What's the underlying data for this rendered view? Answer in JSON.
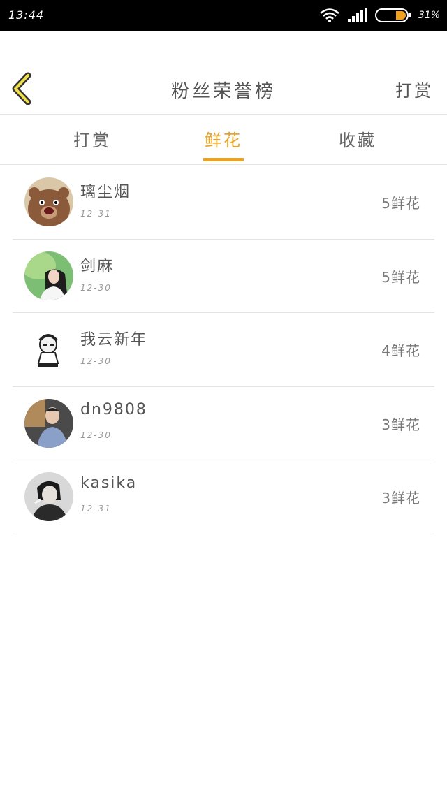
{
  "status_bar": {
    "time": "13:44",
    "battery": "31%"
  },
  "nav": {
    "title": "粉丝荣誉榜",
    "action": "打赏"
  },
  "tabs": [
    {
      "label": "打赏",
      "active": false
    },
    {
      "label": "鲜花",
      "active": true
    },
    {
      "label": "收藏",
      "active": false
    }
  ],
  "colors": {
    "accent": "#e8a324",
    "text": "#666666",
    "divider": "#e3e3e3"
  },
  "items": [
    {
      "name": "璃尘烟",
      "date": "12-31",
      "count": "5鲜花"
    },
    {
      "name": "剑麻",
      "date": "12-30",
      "count": "5鲜花"
    },
    {
      "name": "我云新年",
      "date": "12-30",
      "count": "4鲜花"
    },
    {
      "name": "dn9808",
      "date": "12-30",
      "count": "3鲜花"
    },
    {
      "name": "kasika",
      "date": "12-31",
      "count": "3鲜花"
    }
  ]
}
